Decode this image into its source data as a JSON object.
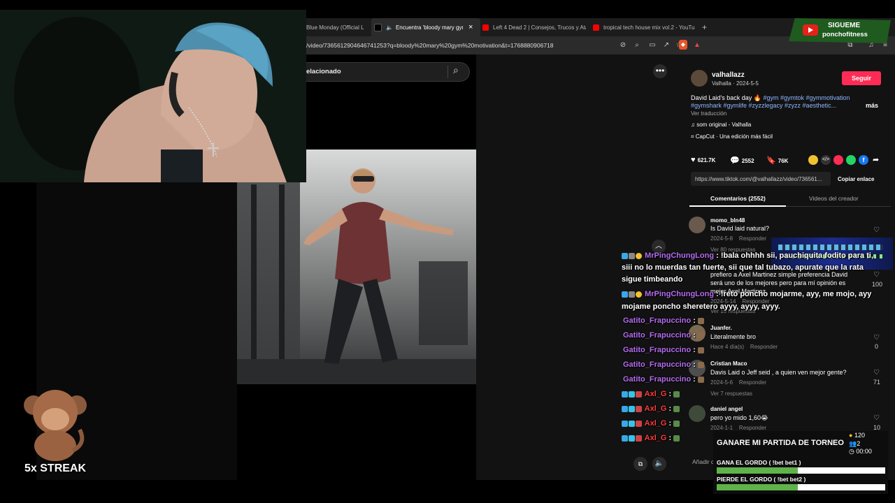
{
  "tabs": [
    {
      "label": "Blue Monday (Official L",
      "icon": "youtube-icon"
    },
    {
      "label": "Encuentra 'bloody mary gym",
      "icon": "tiktok-icon",
      "active": true,
      "close": "×"
    },
    {
      "label": "Left 4 Dead 2 | Consejos, Trucos y Ata",
      "icon": "youtube-icon"
    },
    {
      "label": "tropical tech house mix vol.2 - YouTu",
      "icon": "youtube-icon"
    }
  ],
  "new_tab": "+",
  "url": "/video/7365612904646741253?q=bloody%20mary%20gym%20motivation&t=1768880906718",
  "search": {
    "value": "elacionado"
  },
  "overlay": {
    "follow_title": "SIGUEME",
    "follow_handle": "ponchofitness"
  },
  "streak": {
    "label": "5x STREAK"
  },
  "post": {
    "username": "valhallazz",
    "subtitle": "Valhalla · 2024-5-5",
    "follow_label": "Seguir",
    "desc_line1": "David Laid's back day 🔥 ",
    "desc_tags1": "#gym #gymtok #gymmotivation",
    "desc_tags2": "#gymshark #gymlife #zyzzlegacy #zyzz #aesthetic...",
    "more": "más",
    "translate": "Ver traducción",
    "music": "som original - Valhalla",
    "capcut": "CapCut · Una edición más fácil",
    "likes": "621.7K",
    "comments": "2552",
    "saves": "76K",
    "link": "https://www.tiktok.com/@valhallazz/video/736561...",
    "copy_label": "Copiar enlace",
    "tab_comments": "Comentarios (2552)",
    "tab_creator": "Videos del creador"
  },
  "comments": [
    {
      "user": "momo_bln48",
      "text": "Is David laid natural?",
      "meta": "2024-5-8",
      "reply": "Responder",
      "replies": "Ver 80 respuestas",
      "likes": ""
    },
    {
      "user": "",
      "text": "prefiero a Axel Martinez simple preferencia David",
      "text2": "será uno de los mejores pero para mí opinión es",
      "text3": "mejor Axel Martinez",
      "meta": "2024-5-14",
      "reply": "Responder",
      "replies": "Ver 15 respuestas",
      "likes": "100"
    },
    {
      "user": "Juanfer.",
      "text": "Literalmente bro",
      "meta": "Hace 4 día(s)",
      "reply": "Responder",
      "likes": "0"
    },
    {
      "user": "Cristian Maco",
      "text": "Davis Laid o Jeff seid , a quien ven mejor gente?",
      "meta": "2024-5-6",
      "reply": "Responder",
      "replies": "Ver 7 respuestas",
      "likes": "71"
    },
    {
      "user": "daniel angel",
      "text": "pero yo mido 1,60😭",
      "meta": "2024-1-1",
      "reply": "Responder",
      "likes": "10"
    }
  ],
  "add_comment": "Añadir co",
  "chat": [
    {
      "user": "MrPingChungLong",
      "color": "#b56cf0",
      "text": ": !bala ohhhh sii, pauchiquita fodito para ti,",
      "text2": "siii no lo muerdas tan fuerte, sii que tal tubazo, apurate que la rata",
      "text3": "sigue timbeando"
    },
    {
      "user": "MrPingChungLong",
      "color": "#b56cf0",
      "text": ": !reto poncho mojarme, ayy, me mojo, ayy",
      "text2": "mojame poncho sheretero ayyy, ayyy, ayyy."
    },
    {
      "user": "Gatito_Frapuccino",
      "color": "#b56cf0",
      "text": ":"
    },
    {
      "user": "Gatito_Frapuccino",
      "color": "#b56cf0",
      "text": ":"
    },
    {
      "user": "Gatito_Frapuccino",
      "color": "#b56cf0",
      "text": ":"
    },
    {
      "user": "Gatito_Frapuccino",
      "color": "#b56cf0",
      "text": ":"
    },
    {
      "user": "Gatito_Frapuccino",
      "color": "#b56cf0",
      "text": ":"
    },
    {
      "user": "Axl_G",
      "color": "#ff3b3b",
      "text": ":"
    },
    {
      "user": "Axl_G",
      "color": "#ff3b3b",
      "text": ":"
    },
    {
      "user": "Axl_G",
      "color": "#ff3b3b",
      "text": ":"
    },
    {
      "user": "Axl_G",
      "color": "#ff3b3b",
      "text": ":"
    }
  ],
  "poll": {
    "title": "GANARE MI PARTIDA DE TORNEO",
    "points": "120",
    "users": "2",
    "time": "00:00",
    "option1": "GANA EL GORDO ( !bet bet1 )",
    "option1_pct": 0.48,
    "option2": "PIERDE EL GORDO ( !bet bet2 )",
    "option2_pct": 0.48
  },
  "colors": {
    "accent": "#fe2c55",
    "hashtag": "#8fb6ff",
    "bar_fill": "#5fb34a"
  }
}
